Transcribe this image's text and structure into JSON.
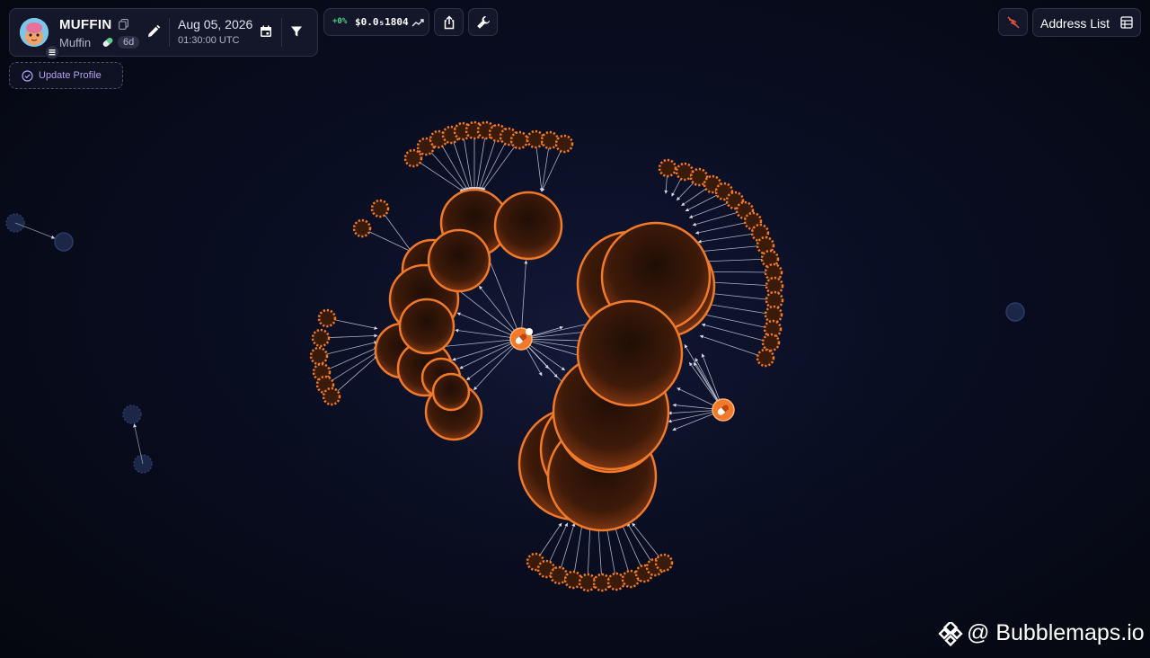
{
  "token": {
    "name": "MUFFIN",
    "symbol": "Muffin",
    "age": "6d",
    "date": "Aug 05, 2026",
    "time": "01:30:00 UTC"
  },
  "price": {
    "change": "+0%",
    "value": "$0.0₅1804"
  },
  "actions": {
    "update_profile": "Update Profile",
    "address_list": "Address List"
  },
  "brand": {
    "text": "@ Bubblemaps.io"
  },
  "colors": {
    "bubble_stroke": "#f07a2a",
    "bubble_fill_inner": "#2a1408",
    "bubble_fill_outer": "#6a2c10",
    "dimmed_bubble": "#1c2647",
    "link": "#c9cede",
    "price_up": "#4fd18b",
    "accent_purple": "#b3a3f2"
  },
  "icons": {
    "copy": "copy-icon",
    "edit": "pencil-icon",
    "calendar": "calendar-icon",
    "filter": "filter-icon",
    "trend": "trend-line-icon",
    "share": "share-icon",
    "tools": "wrench-icon",
    "hide_links": "hidden-links-icon",
    "address_list": "table-list-icon",
    "update": "check-circle-icon",
    "brand": "bubblemaps-logo-icon"
  }
}
